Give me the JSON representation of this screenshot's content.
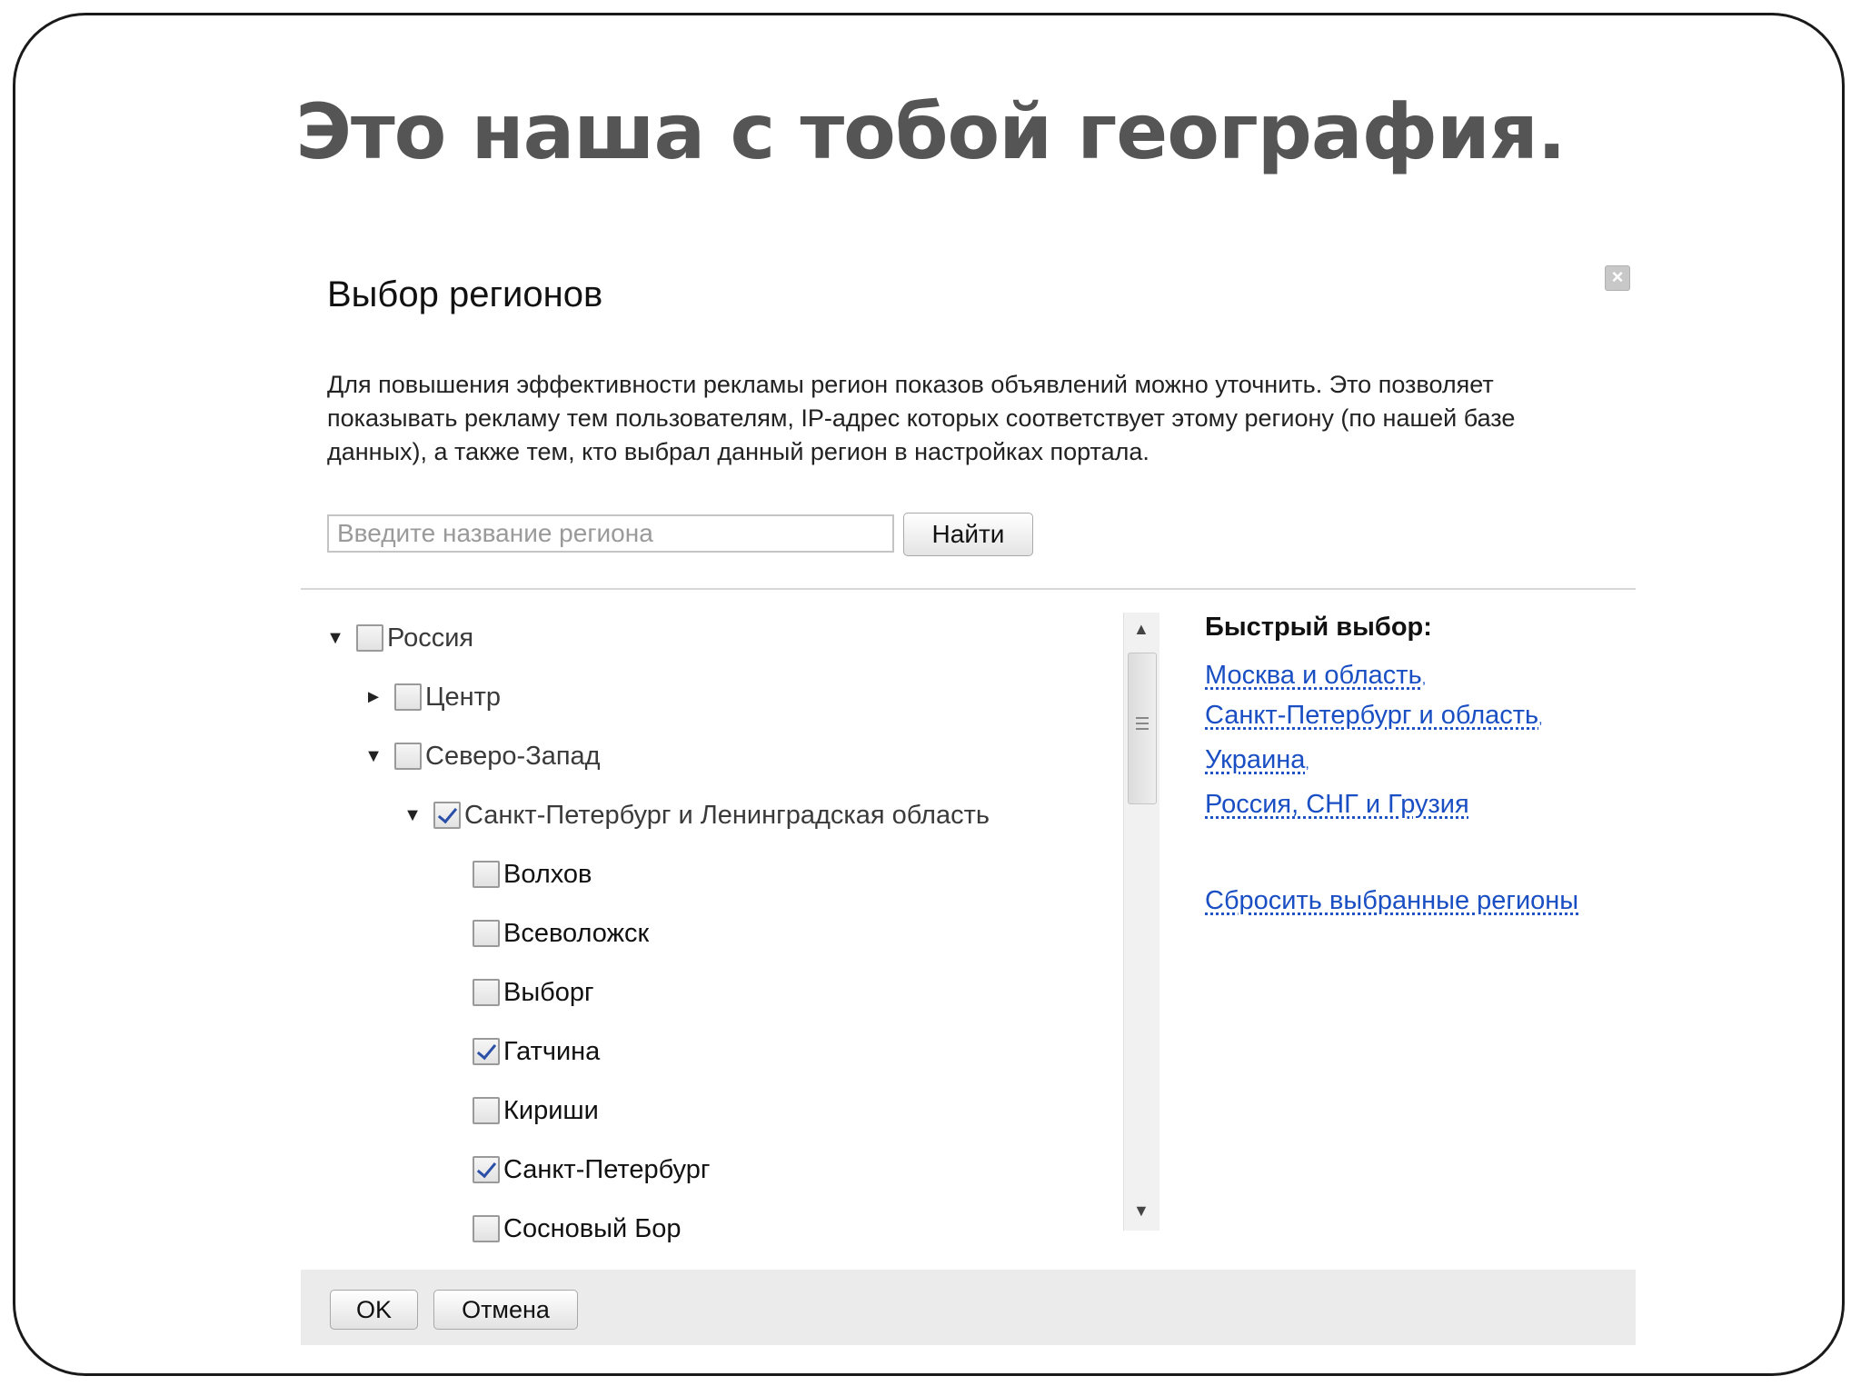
{
  "slide": {
    "title": "Это наша с тобой география."
  },
  "dialog": {
    "title": "Выбор регионов",
    "description": "Для повышения эффективности рекламы регион показов объявлений можно уточнить. Это позволяет показывать рекламу тем пользователям, IP-адрес которых соответствует этому региону (по нашей базе данных), а также тем, кто выбрал данный регион в настройках портала.",
    "search": {
      "value": "",
      "placeholder": "Введите название региона",
      "button_label": "Найти"
    },
    "tree": [
      {
        "label": "Россия",
        "expanded": true,
        "checked": false
      },
      {
        "label": "Центр",
        "expanded": false,
        "checked": false
      },
      {
        "label": "Северо-Запад",
        "expanded": true,
        "checked": false
      },
      {
        "label": "Санкт-Петербург и Ленинградская область",
        "expanded": true,
        "checked": true
      },
      {
        "label": "Волхов",
        "checked": false
      },
      {
        "label": "Всеволожск",
        "checked": false
      },
      {
        "label": "Выборг",
        "checked": false
      },
      {
        "label": "Гатчина",
        "checked": true
      },
      {
        "label": "Кириши",
        "checked": false
      },
      {
        "label": "Санкт-Петербург",
        "checked": true
      },
      {
        "label": "Сосновый Бор",
        "checked": false
      }
    ],
    "quick": {
      "title": "Быстрый выбор:",
      "links": [
        {
          "label": "Москва и область",
          "sep": ","
        },
        {
          "label": "Санкт-Петербург и область",
          "sep": ","
        },
        {
          "label": "Украина",
          "sep": ","
        },
        {
          "label": "Россия, СНГ и Грузия",
          "sep": ""
        }
      ],
      "reset_label": "Сбросить выбранные регионы"
    },
    "footer": {
      "ok_label": "OK",
      "cancel_label": "Отмена"
    }
  },
  "icons": {
    "close": "close-icon",
    "expanded": "triangle-down-icon",
    "collapsed": "triangle-right-icon",
    "scroll_up": "arrow-up-icon",
    "scroll_down": "arrow-down-icon"
  },
  "colors": {
    "link": "#1a4fc4",
    "title": "#555555",
    "check": "#2b4fa8"
  }
}
